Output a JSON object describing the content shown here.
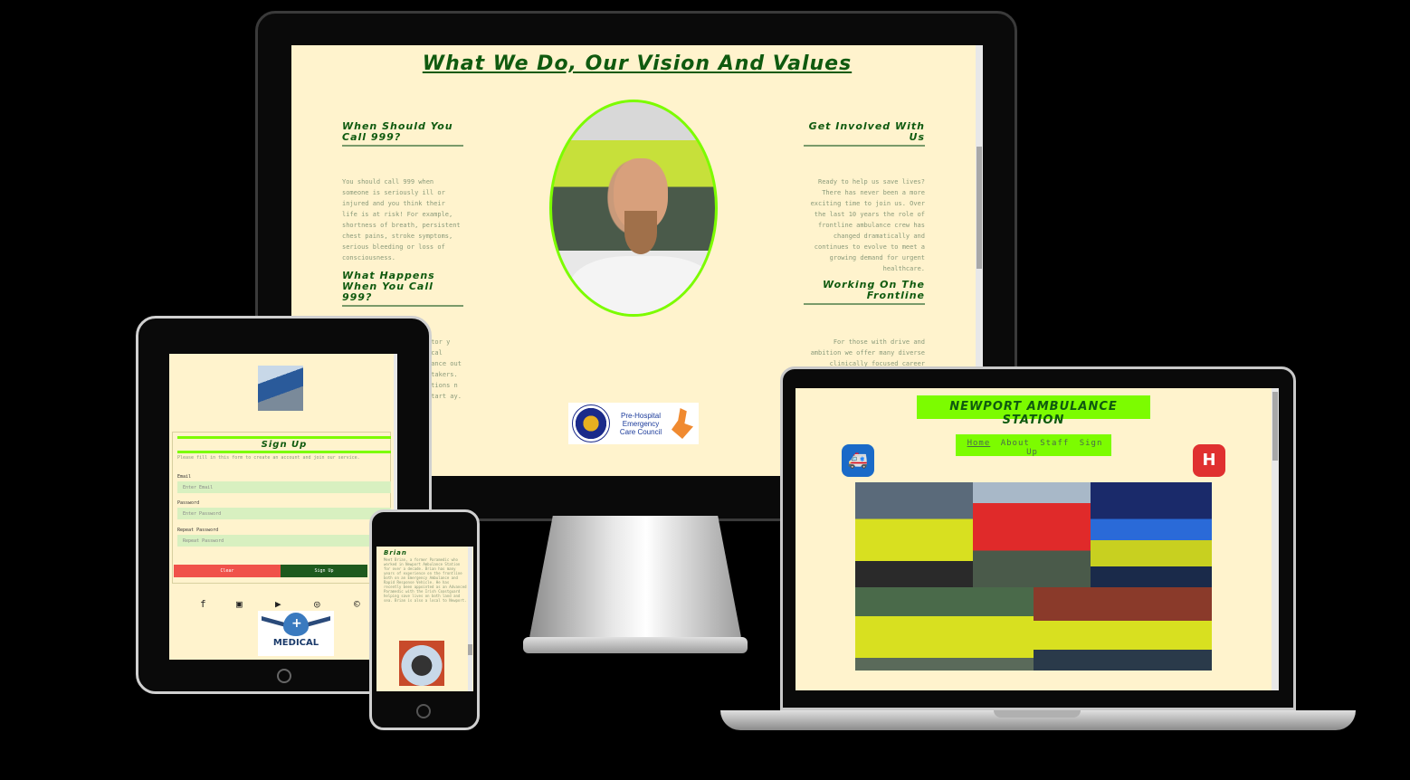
{
  "desktop": {
    "title": "What We Do, Our Vision And Values",
    "left_col": [
      {
        "heading": "When Should You Call 999?",
        "text": "You should call 999 when someone is seriously ill or injured and you think their life is at risk! For example, shortness of breath, persistent chest pains, stroke symptoms, serious bleeding or loss of consciousness."
      },
      {
        "heading": "What Happens When You Call 999?",
        "text": "ator y ical lance out -takers. stions n start ay."
      }
    ],
    "right_col": [
      {
        "heading": "Get Involved With Us",
        "text": "Ready to help us save lives? There has never been a more exciting time to join us. Over the last 10 years the role of frontline ambulance crew has changed dramatically and continues to evolve to meet a growing demand for urgent healthcare."
      },
      {
        "heading": "Working On The Frontline",
        "text": "For those with drive and ambition we offer many diverse clinically focused career opportunities to"
      }
    ],
    "logo_text": "Pre-Hospital Emergency Care Council"
  },
  "tablet": {
    "signup_title": "Sign Up",
    "signup_subtitle": "Please fill in this form to create an account and join our service.",
    "email_label": "Email",
    "email_placeholder": "Enter Email",
    "password_label": "Password",
    "password_placeholder": "Enter Password",
    "repeat_label": "Repeat Password",
    "repeat_placeholder": "Repeat Password",
    "clear_label": "Clear",
    "signup_label": "Sign Up",
    "social_icons": [
      "facebook-icon",
      "twitter-icon",
      "youtube-icon",
      "instagram-icon",
      "copyright-icon"
    ],
    "social_glyphs": [
      "f",
      "▣",
      "▶",
      "◎",
      "©"
    ],
    "medical_logo_text": "MEDICAL"
  },
  "phone": {
    "name": "Brian",
    "bio": "Meet Brian, a former Paramedic who worked in Newport Ambulance Station for over a decade. Brian has many years of experience on the frontline both on an Emergency Ambulance and Rapid Response Vehicle. He has recently been appointed as an Advanced Paramedic with the Irish Coastguard helping save lives on both land and sea. Brian is also a local to Newport."
  },
  "laptop": {
    "station_title": "NEWPORT AMBULANCE STATION",
    "nav": [
      "Home",
      "About",
      "Staff",
      "Sign Up"
    ],
    "ambulance_glyph": "🚑",
    "hospital_glyph": "H"
  }
}
